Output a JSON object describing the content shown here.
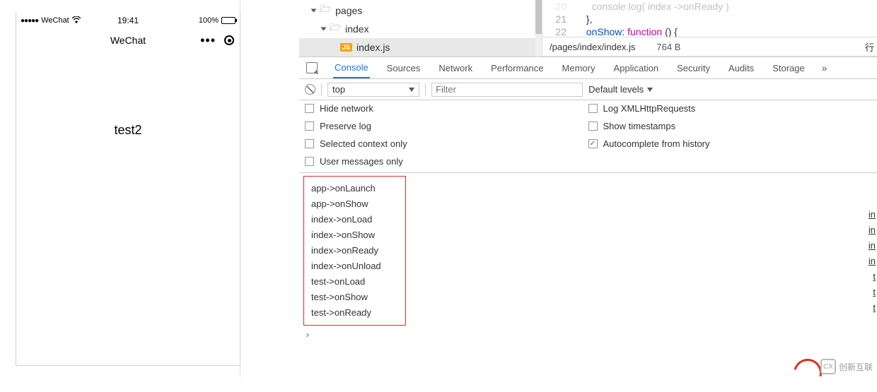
{
  "phone": {
    "carrier": "WeChat",
    "time": "19:41",
    "battery": "100%",
    "title": "WeChat",
    "content_text": "test2"
  },
  "file_tree": {
    "root": "pages",
    "folder": "index",
    "file": "index.js",
    "file_badge": "JS"
  },
  "code": {
    "line_nums": [
      "20",
      "21",
      "22"
    ],
    "l20_part": "},",
    "l21_part1": "onShow",
    "l21_part2": ": ",
    "l21_kw": "function",
    "l21_part3": " () {",
    "path": "/pages/index/index.js",
    "size": "764 B",
    "right_char": "行"
  },
  "devtools": {
    "tabs": [
      "Console",
      "Sources",
      "Network",
      "Performance",
      "Memory",
      "Application",
      "Security",
      "Audits",
      "Storage"
    ],
    "toolbar": {
      "context": "top",
      "filter_placeholder": "Filter",
      "levels": "Default levels"
    },
    "options_left": [
      "Hide network",
      "Preserve log",
      "Selected context only",
      "User messages only"
    ],
    "options_right": [
      {
        "label": "Log XMLHttpRequests",
        "checked": false
      },
      {
        "label": "Show timestamps",
        "checked": false
      },
      {
        "label": "Autocomplete from history",
        "checked": true
      }
    ],
    "console_lines": [
      "app->onLaunch",
      "app->onShow",
      "index->onLoad",
      "index->onShow",
      "index->onReady",
      "index->onUnload",
      "test->onLoad",
      "test->onShow",
      "test->onReady"
    ],
    "link_hints": [
      "in",
      "in",
      "in",
      "in",
      "t",
      "t",
      "t"
    ],
    "prompt": "›"
  },
  "watermark": {
    "badge": "CX",
    "text": "创新互联"
  }
}
